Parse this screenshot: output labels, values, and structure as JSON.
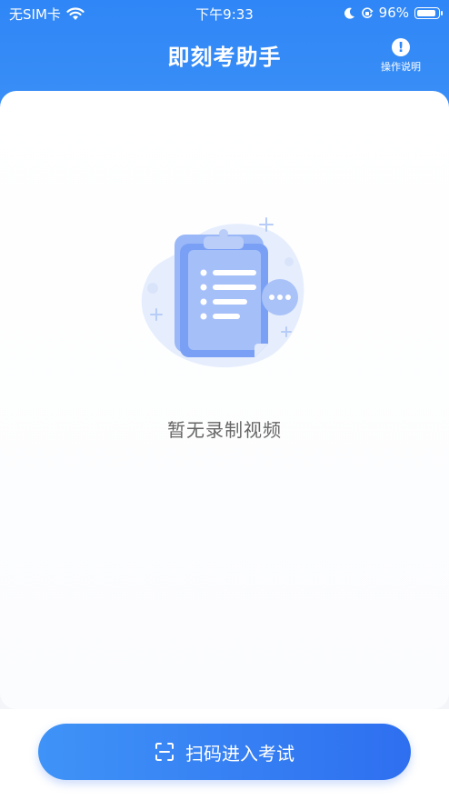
{
  "status_bar": {
    "carrier": "无SIM卡",
    "time": "下午9:33",
    "battery": "96%",
    "battery_level": 0.96
  },
  "nav": {
    "title": "即刻考助手",
    "help_icon_glyph": "!",
    "help_label": "操作说明"
  },
  "empty_state": {
    "message": "暂无录制视频",
    "icon": "empty-clipboard-icon"
  },
  "actions": {
    "scan_button_label": "扫码进入考试",
    "scan_icon": "scan-icon"
  },
  "colors": {
    "primary": "#2f86f6",
    "button_gradient_end": "#2e6ff0",
    "illustration": "#7aa0f5"
  }
}
